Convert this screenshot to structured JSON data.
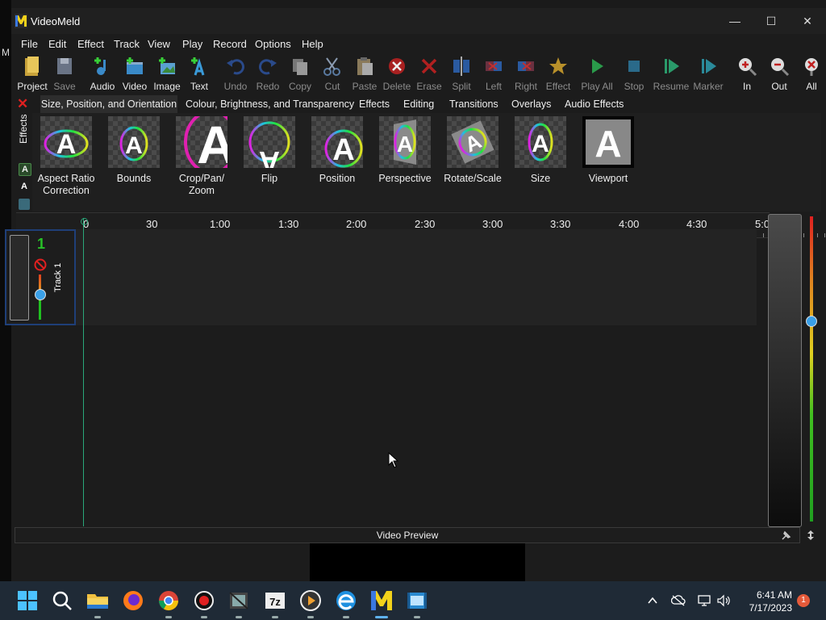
{
  "app": {
    "title": "VideoMeld",
    "desktop_letter": "M"
  },
  "window_controls": {
    "minimize": "—",
    "maximize": "☐",
    "close": "✕"
  },
  "menu": [
    "File",
    "Edit",
    "Effect",
    "Track",
    "View",
    "Play",
    "Record",
    "Options",
    "Help"
  ],
  "toolbar": [
    {
      "label": "Project",
      "icon": "project-icon",
      "enabled": true
    },
    {
      "label": "Save",
      "icon": "save-icon",
      "enabled": false
    },
    {
      "label": "Audio",
      "icon": "add-audio-icon",
      "enabled": true
    },
    {
      "label": "Video",
      "icon": "add-video-icon",
      "enabled": true
    },
    {
      "label": "Image",
      "icon": "add-image-icon",
      "enabled": true
    },
    {
      "label": "Text",
      "icon": "add-text-icon",
      "enabled": true
    },
    {
      "label": "Undo",
      "icon": "undo-icon",
      "enabled": false
    },
    {
      "label": "Redo",
      "icon": "redo-icon",
      "enabled": false
    },
    {
      "label": "Copy",
      "icon": "copy-icon",
      "enabled": false
    },
    {
      "label": "Cut",
      "icon": "cut-icon",
      "enabled": false
    },
    {
      "label": "Paste",
      "icon": "paste-icon",
      "enabled": false
    },
    {
      "label": "Delete",
      "icon": "delete-icon",
      "enabled": false
    },
    {
      "label": "Erase",
      "icon": "erase-icon",
      "enabled": false
    },
    {
      "label": "Split",
      "icon": "split-icon",
      "enabled": false
    },
    {
      "label": "Left",
      "icon": "trim-left-icon",
      "enabled": false
    },
    {
      "label": "Right",
      "icon": "trim-right-icon",
      "enabled": false
    },
    {
      "label": "Effect",
      "icon": "effect-star-icon",
      "enabled": false
    },
    {
      "label": "Play All",
      "icon": "play-all-icon",
      "enabled": false
    },
    {
      "label": "Stop",
      "icon": "stop-icon",
      "enabled": false
    },
    {
      "label": "Resume",
      "icon": "resume-icon",
      "enabled": false
    },
    {
      "label": "Marker",
      "icon": "marker-icon",
      "enabled": false
    },
    {
      "label": "In",
      "icon": "zoom-in-icon",
      "enabled": true
    },
    {
      "label": "Out",
      "icon": "zoom-out-icon",
      "enabled": true
    },
    {
      "label": "All",
      "icon": "zoom-all-icon",
      "enabled": true
    }
  ],
  "effects_tabs": {
    "side_label": "Effects",
    "tabs": [
      "Size, Position, and Orientation",
      "Colour, Brightness, and Transparency",
      "Effects",
      "Editing",
      "Transitions",
      "Overlays",
      "Audio Effects"
    ],
    "active": 0
  },
  "effects": [
    {
      "label": "Aspect Ratio Correction",
      "icon": "aspect-ratio-icon"
    },
    {
      "label": "Bounds",
      "icon": "bounds-icon"
    },
    {
      "label": "Crop/Pan/ Zoom",
      "icon": "crop-pan-zoom-icon"
    },
    {
      "label": "Flip",
      "icon": "flip-icon"
    },
    {
      "label": "Position",
      "icon": "position-icon"
    },
    {
      "label": "Perspective",
      "icon": "perspective-icon"
    },
    {
      "label": "Rotate/Scale",
      "icon": "rotate-scale-icon"
    },
    {
      "label": "Size",
      "icon": "size-icon"
    },
    {
      "label": "Viewport",
      "icon": "viewport-icon"
    }
  ],
  "ruler": [
    "0",
    "30",
    "1:00",
    "1:30",
    "2:00",
    "2:30",
    "3:00",
    "3:30",
    "4:00",
    "4:30",
    "5:0"
  ],
  "track": {
    "number": "1",
    "name": "Track 1"
  },
  "preview": {
    "label": "Video Preview"
  },
  "taskbar": {
    "apps": [
      "start-icon",
      "search-icon",
      "file-explorer-icon",
      "firefox-icon",
      "chrome-icon",
      "record-icon",
      "movie-app-icon",
      "7zip-icon",
      "media-player-icon",
      "edge-icon",
      "videomeld-icon",
      "screen-capture-icon"
    ],
    "time": "6:41 AM",
    "date": "7/17/2023",
    "notifications": "1"
  }
}
